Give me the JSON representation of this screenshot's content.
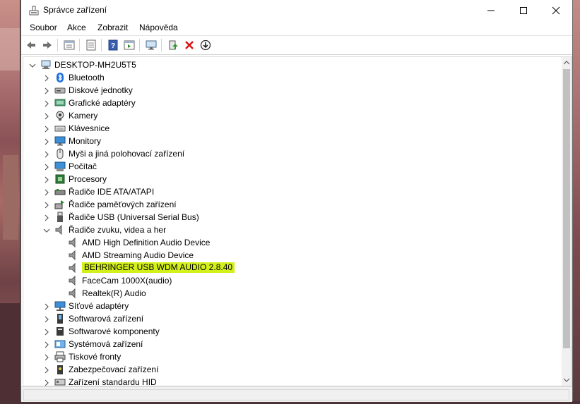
{
  "window": {
    "title": "Správce zařízení"
  },
  "menu": {
    "items": [
      "Soubor",
      "Akce",
      "Zobrazit",
      "Nápověda"
    ]
  },
  "toolbar": {
    "buttons": [
      "back-icon",
      "forward-icon",
      "properties-icon",
      "details-icon",
      "help-icon",
      "view-icon",
      "monitor-icon",
      "update-driver-icon",
      "uninstall-icon",
      "download-icon"
    ]
  },
  "tree": {
    "root": "DESKTOP-MH2U5T5",
    "categories": [
      {
        "label": "Bluetooth",
        "icon": "bluetooth-icon"
      },
      {
        "label": "Diskové jednotky",
        "icon": "disk-drive-icon"
      },
      {
        "label": "Grafické adaptéry",
        "icon": "display-adapter-icon"
      },
      {
        "label": "Kamery",
        "icon": "camera-icon"
      },
      {
        "label": "Klávesnice",
        "icon": "keyboard-icon"
      },
      {
        "label": "Monitory",
        "icon": "monitor-icon"
      },
      {
        "label": "Myši a jiná polohovací zařízení",
        "icon": "mouse-icon"
      },
      {
        "label": "Počítač",
        "icon": "computer-icon"
      },
      {
        "label": "Procesory",
        "icon": "processor-icon"
      },
      {
        "label": "Řadiče IDE ATA/ATAPI",
        "icon": "ide-controller-icon"
      },
      {
        "label": "Řadiče paměťových zařízení",
        "icon": "storage-controller-icon"
      },
      {
        "label": "Řadiče USB (Universal Serial Bus)",
        "icon": "usb-icon"
      },
      {
        "label": "Řadiče zvuku, videa a her",
        "icon": "speaker-icon",
        "expanded": true,
        "children": [
          {
            "label": "AMD High Definition Audio Device"
          },
          {
            "label": "AMD Streaming Audio Device"
          },
          {
            "label": "BEHRINGER USB WDM AUDIO 2.8.40",
            "highlighted": true
          },
          {
            "label": "FaceCam 1000X(audio)"
          },
          {
            "label": "Realtek(R) Audio"
          }
        ]
      },
      {
        "label": "Síťové adaptéry",
        "icon": "network-adapter-icon"
      },
      {
        "label": "Softwarová zařízení",
        "icon": "software-device-icon"
      },
      {
        "label": "Softwarové komponenty",
        "icon": "software-component-icon"
      },
      {
        "label": "Systémová zařízení",
        "icon": "system-device-icon"
      },
      {
        "label": "Tiskové fronty",
        "icon": "printer-icon"
      },
      {
        "label": "Zabezpečovací zařízení",
        "icon": "security-device-icon"
      },
      {
        "label": "Zařízení standardu HID",
        "icon": "hid-icon"
      }
    ]
  },
  "colors": {
    "highlight": "#d4f01a",
    "selection_accent": "#0078d7"
  }
}
